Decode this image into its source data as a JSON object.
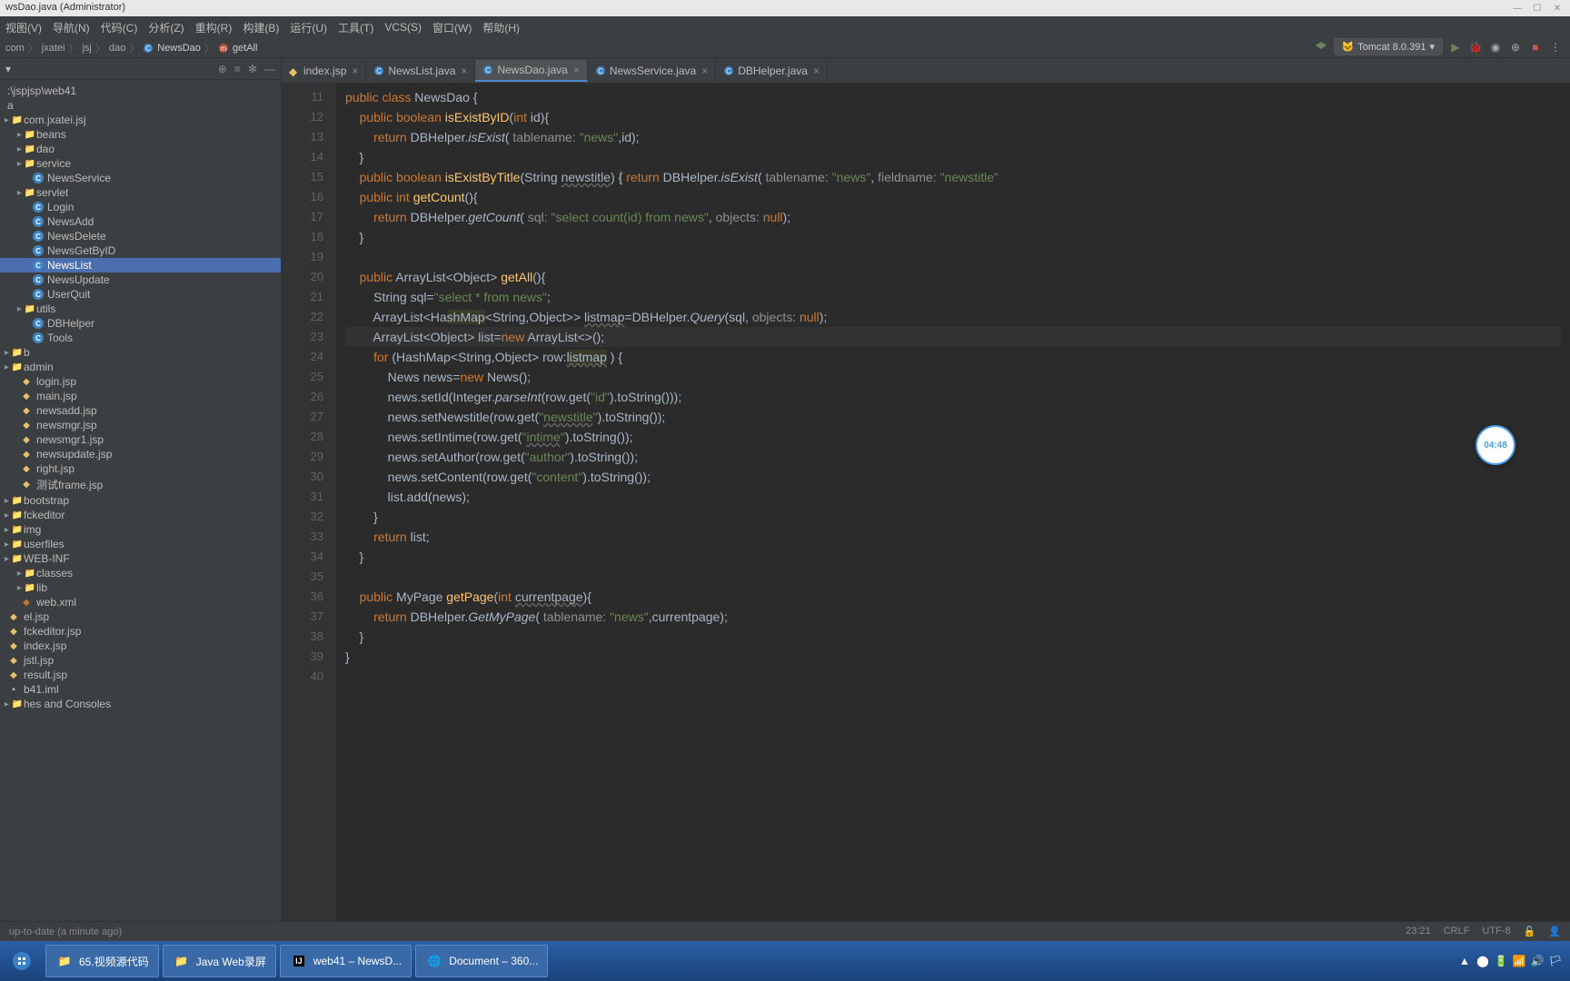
{
  "window": {
    "title": "wsDao.java (Administrator)"
  },
  "menu": [
    "视图(V)",
    "导航(N)",
    "代码(C)",
    "分析(Z)",
    "重构(R)",
    "构建(B)",
    "运行(U)",
    "工具(T)",
    "VCS(S)",
    "窗口(W)",
    "帮助(H)"
  ],
  "runConfig": {
    "icon": "tomcat-icon",
    "label": "Tomcat 8.0.391"
  },
  "breadcrumb": [
    {
      "label": "com",
      "kind": "folder"
    },
    {
      "label": "jxatei",
      "kind": "folder"
    },
    {
      "label": "jsj",
      "kind": "folder"
    },
    {
      "label": "dao",
      "kind": "folder"
    },
    {
      "label": "NewsDao",
      "kind": "class"
    },
    {
      "label": "getAll",
      "kind": "method"
    }
  ],
  "project": {
    "root": ":\\jspjsp\\web41",
    "rootSub": "a",
    "tree": [
      {
        "label": "com.jxatei.jsj",
        "kind": "pkg",
        "indent": 0
      },
      {
        "label": "beans",
        "kind": "folder",
        "indent": 1
      },
      {
        "label": "dao",
        "kind": "folder",
        "indent": 1
      },
      {
        "label": "service",
        "kind": "folder",
        "indent": 1
      },
      {
        "label": "NewsService",
        "kind": "class",
        "indent": 2
      },
      {
        "label": "servlet",
        "kind": "folder",
        "indent": 1
      },
      {
        "label": "Login",
        "kind": "class",
        "indent": 2
      },
      {
        "label": "NewsAdd",
        "kind": "class",
        "indent": 2
      },
      {
        "label": "NewsDelete",
        "kind": "class",
        "indent": 2
      },
      {
        "label": "NewsGetByID",
        "kind": "class",
        "indent": 2
      },
      {
        "label": "NewsList",
        "kind": "class",
        "indent": 2,
        "sel": true
      },
      {
        "label": "NewsUpdate",
        "kind": "class",
        "indent": 2
      },
      {
        "label": "UserQuit",
        "kind": "class",
        "indent": 2
      },
      {
        "label": "utils",
        "kind": "folder",
        "indent": 1
      },
      {
        "label": "DBHelper",
        "kind": "class",
        "indent": 2
      },
      {
        "label": "Tools",
        "kind": "class",
        "indent": 2
      },
      {
        "label": "b",
        "kind": "folder",
        "indent": 0
      },
      {
        "label": "admin",
        "kind": "folder",
        "indent": 0
      },
      {
        "label": "login.jsp",
        "kind": "jsp",
        "indent": 1
      },
      {
        "label": "main.jsp",
        "kind": "jsp",
        "indent": 1
      },
      {
        "label": "newsadd.jsp",
        "kind": "jsp",
        "indent": 1
      },
      {
        "label": "newsmgr.jsp",
        "kind": "jsp",
        "indent": 1
      },
      {
        "label": "newsmgr1.jsp",
        "kind": "jsp",
        "indent": 1
      },
      {
        "label": "newsupdate.jsp",
        "kind": "jsp",
        "indent": 1
      },
      {
        "label": "right.jsp",
        "kind": "jsp",
        "indent": 1
      },
      {
        "label": "测试frame.jsp",
        "kind": "jsp",
        "indent": 1
      },
      {
        "label": "bootstrap",
        "kind": "folder",
        "indent": 0
      },
      {
        "label": "fckeditor",
        "kind": "folder",
        "indent": 0
      },
      {
        "label": "img",
        "kind": "folder",
        "indent": 0
      },
      {
        "label": "userfiles",
        "kind": "folder",
        "indent": 0
      },
      {
        "label": "WEB-INF",
        "kind": "folder",
        "indent": 0
      },
      {
        "label": "classes",
        "kind": "folder",
        "indent": 1
      },
      {
        "label": "lib",
        "kind": "folder",
        "indent": 1
      },
      {
        "label": "web.xml",
        "kind": "xml",
        "indent": 1
      },
      {
        "label": "el.jsp",
        "kind": "jsp",
        "indent": 0
      },
      {
        "label": "fckeditor.jsp",
        "kind": "jsp",
        "indent": 0
      },
      {
        "label": "index.jsp",
        "kind": "jsp",
        "indent": 0
      },
      {
        "label": "jstl.jsp",
        "kind": "jsp",
        "indent": 0
      },
      {
        "label": "result.jsp",
        "kind": "jsp",
        "indent": 0
      },
      {
        "label": "b41.iml",
        "kind": "iml",
        "indent": 0
      },
      {
        "label": "hes and Consoles",
        "kind": "folder",
        "indent": 0
      }
    ]
  },
  "tabs": [
    {
      "label": "index.jsp",
      "kind": "jsp"
    },
    {
      "label": "NewsList.java",
      "kind": "java"
    },
    {
      "label": "NewsDao.java",
      "kind": "java",
      "active": true
    },
    {
      "label": "NewsService.java",
      "kind": "java"
    },
    {
      "label": "DBHelper.java",
      "kind": "java"
    }
  ],
  "code": {
    "start": 11,
    "current": 23,
    "lines": [
      {
        "n": 11,
        "html": "<span class='kw'>public class</span> NewsDao {"
      },
      {
        "n": 12,
        "html": "    <span class='kw'>public boolean</span> <span class='mth'>isExistByID</span>(<span class='kw'>int</span> id){"
      },
      {
        "n": 13,
        "html": "        <span class='kw'>return</span> DBHelper.<span class='ital'>isExist</span>( <span class='param'>tablename:</span> <span class='str'>\"news\"</span>,id);"
      },
      {
        "n": 14,
        "html": "    }"
      },
      {
        "n": 15,
        "html": "    <span class='kw'>public boolean</span> <span class='mth'>isExistByTitle</span>(String <span class='under'>newstitle</span>) <span class='hl'>{</span> <span class='kw'>return</span> DBHelper.<span class='ital'>isExist</span>( <span class='param'>tablename:</span> <span class='str'>\"news\"</span>, <span class='param'>fieldname:</span> <span class='str'>\"newstitle\"</span>"
      },
      {
        "n": 16,
        "html": "    <span class='kw'>public int</span> <span class='mth'>getCount</span>(){"
      },
      {
        "n": 17,
        "html": "        <span class='kw'>return</span> DBHelper.<span class='ital'>getCount</span>( <span class='param'>sql:</span> <span class='str'>\"select count(id) from news\"</span>, <span class='param'>objects:</span> <span class='kw'>null</span>);"
      },
      {
        "n": 18,
        "html": "    }"
      },
      {
        "n": 19,
        "html": ""
      },
      {
        "n": 20,
        "html": "    <span class='kw'>public</span> ArrayList&lt;Object&gt; <span class='mth'>getAll</span>(){"
      },
      {
        "n": 21,
        "html": "        String sql=<span class='str'>\"select * from news\"</span>;"
      },
      {
        "n": 22,
        "html": "        ArrayList&lt;Ha<span class='hl'>shMap</span>&lt;String,Object&gt;&gt; <span class='under'>listmap</span>=DBHelper.<span class='ital'>Query</span>(sql, <span class='param'>objects:</span> <span class='kw'>null</span>);"
      },
      {
        "n": 23,
        "html": "        ArrayList&lt;Object&gt; list=<span class='kw'>new</span> ArrayList&lt;&gt;();"
      },
      {
        "n": 24,
        "html": "        <span class='kw'>for</span> (HashMap&lt;String,Object&gt; row:<span class='hl under'>listmap</span> ) {"
      },
      {
        "n": 25,
        "html": "            News news=<span class='kw'>new</span> News();"
      },
      {
        "n": 26,
        "html": "            news.setId(Integer.<span class='ital'>parseInt</span>(row.get(<span class='str'>\"id\"</span>).toString()));"
      },
      {
        "n": 27,
        "html": "            news.setNewstitle(row.get(<span class='str'>\"<span class='under'>newstitle</span>\"</span>).toString());"
      },
      {
        "n": 28,
        "html": "            news.setIntime(row.get(<span class='str'>\"<span class='under'>intime</span>\"</span>).toString());"
      },
      {
        "n": 29,
        "html": "            news.setAuthor(row.get(<span class='str'>\"author\"</span>).toString());"
      },
      {
        "n": 30,
        "html": "            news.setContent(row.get(<span class='str'>\"content\"</span>).toString());"
      },
      {
        "n": 31,
        "html": "            list.add(news);"
      },
      {
        "n": 32,
        "html": "        }"
      },
      {
        "n": 33,
        "html": "        <span class='kw'>return</span> list;"
      },
      {
        "n": 34,
        "html": "    }"
      },
      {
        "n": 35,
        "html": ""
      },
      {
        "n": 36,
        "html": "    <span class='kw'>public</span> MyPage <span class='mth'>getPage</span>(<span class='kw'>int</span> <span class='under'>currentpage</span>){"
      },
      {
        "n": 37,
        "html": "        <span class='kw'>return</span> DBHelper.<span class='ital'>GetMyPage</span>( <span class='param'>tablename:</span> <span class='str'>\"news\"</span>,currentpage);"
      },
      {
        "n": 38,
        "html": "    }"
      },
      {
        "n": 39,
        "html": "}"
      },
      {
        "n": 40,
        "html": ""
      }
    ],
    "lineNumbers": [
      11,
      12,
      13,
      14,
      15,
      16,
      17,
      18,
      19,
      20,
      21,
      22,
      23,
      24,
      25,
      26,
      27,
      28,
      29,
      30,
      31,
      32,
      33,
      34,
      35,
      36,
      37,
      38,
      39,
      40
    ]
  },
  "status": {
    "left": "up-to-date (a minute ago)",
    "pos": "23:21",
    "sep": "CRLF",
    "enc": "UTF-8"
  },
  "taskbar": {
    "tasks": [
      {
        "label": "65.视频源代码",
        "icon": "folder-yellow"
      },
      {
        "label": "Java Web录屏",
        "icon": "folder-yellow"
      },
      {
        "label": "web41 – NewsD...",
        "icon": "intellij"
      },
      {
        "label": "Document – 360...",
        "icon": "browser-green"
      }
    ]
  },
  "timer": "04:48"
}
